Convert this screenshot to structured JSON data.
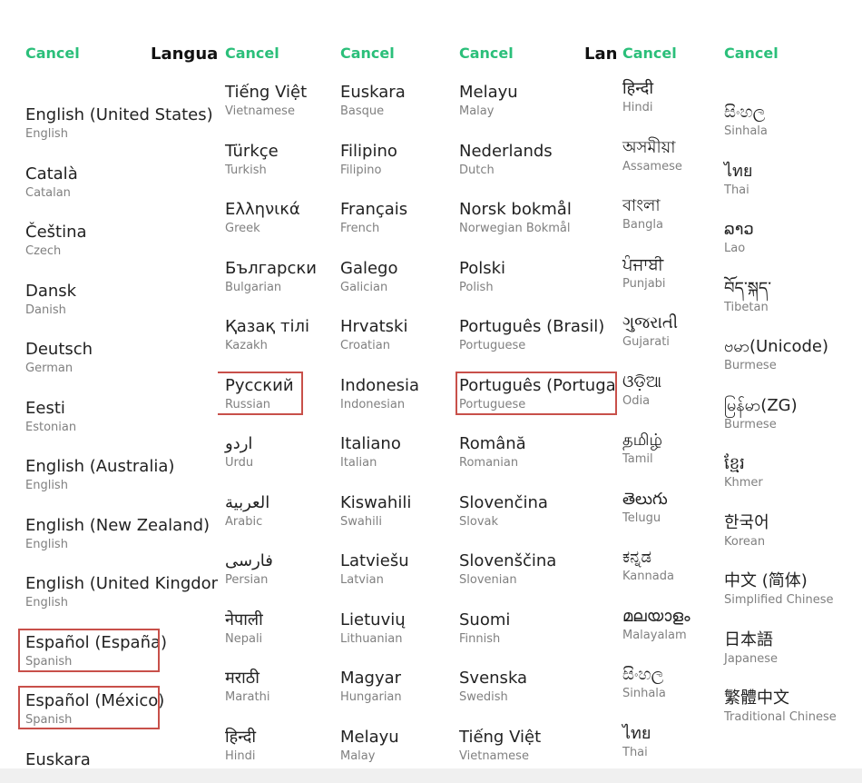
{
  "columns": [
    {
      "cancel": "Cancel",
      "title": "Languag",
      "items": [
        {
          "name": "English (United States)",
          "sub": "English"
        },
        {
          "name": "Català",
          "sub": "Catalan"
        },
        {
          "name": "Čeština",
          "sub": "Czech"
        },
        {
          "name": "Dansk",
          "sub": "Danish"
        },
        {
          "name": "Deutsch",
          "sub": "German"
        },
        {
          "name": "Eesti",
          "sub": "Estonian"
        },
        {
          "name": "English (Australia)",
          "sub": "English"
        },
        {
          "name": "English (New Zealand)",
          "sub": "English"
        },
        {
          "name": "English (United Kingdom)",
          "sub": "English"
        },
        {
          "name": "Español (España)",
          "sub": "Spanish"
        },
        {
          "name": "Español (México)",
          "sub": "Spanish"
        },
        {
          "name": "Euskara",
          "sub": ""
        }
      ]
    },
    {
      "cancel": "Cancel",
      "title": "",
      "items": [
        {
          "name": "Tiếng Việt",
          "sub": "Vietnamese"
        },
        {
          "name": "Türkçe",
          "sub": "Turkish"
        },
        {
          "name": "Ελληνικά",
          "sub": "Greek"
        },
        {
          "name": "Български",
          "sub": "Bulgarian"
        },
        {
          "name": "Қазақ тілі",
          "sub": "Kazakh"
        },
        {
          "name": "Русский",
          "sub": "Russian"
        },
        {
          "name": "اردو",
          "sub": "Urdu"
        },
        {
          "name": "العربية",
          "sub": "Arabic"
        },
        {
          "name": "فارسی",
          "sub": "Persian"
        },
        {
          "name": "नेपाली",
          "sub": "Nepali"
        },
        {
          "name": "मराठी",
          "sub": "Marathi"
        },
        {
          "name": "हिन्दी",
          "sub": "Hindi"
        }
      ]
    },
    {
      "cancel": "Cancel",
      "title": "",
      "items": [
        {
          "name": "Euskara",
          "sub": "Basque"
        },
        {
          "name": "Filipino",
          "sub": "Filipino"
        },
        {
          "name": "Français",
          "sub": "French"
        },
        {
          "name": "Galego",
          "sub": "Galician"
        },
        {
          "name": "Hrvatski",
          "sub": "Croatian"
        },
        {
          "name": "Indonesia",
          "sub": "Indonesian"
        },
        {
          "name": "Italiano",
          "sub": "Italian"
        },
        {
          "name": "Kiswahili",
          "sub": "Swahili"
        },
        {
          "name": "Latviešu",
          "sub": "Latvian"
        },
        {
          "name": "Lietuvių",
          "sub": "Lithuanian"
        },
        {
          "name": "Magyar",
          "sub": "Hungarian"
        },
        {
          "name": "Melayu",
          "sub": "Malay"
        }
      ]
    },
    {
      "cancel": "Cancel",
      "title": "Lang",
      "items": [
        {
          "name": "Melayu",
          "sub": "Malay"
        },
        {
          "name": "Nederlands",
          "sub": "Dutch"
        },
        {
          "name": "Norsk bokmål",
          "sub": "Norwegian Bokmål"
        },
        {
          "name": "Polski",
          "sub": "Polish"
        },
        {
          "name": "Português (Brasil)",
          "sub": "Portuguese"
        },
        {
          "name": "Português (Portugal)",
          "sub": "Portuguese"
        },
        {
          "name": "Română",
          "sub": "Romanian"
        },
        {
          "name": "Slovenčina",
          "sub": "Slovak"
        },
        {
          "name": "Slovenščina",
          "sub": "Slovenian"
        },
        {
          "name": "Suomi",
          "sub": "Finnish"
        },
        {
          "name": "Svenska",
          "sub": "Swedish"
        },
        {
          "name": "Tiếng Việt",
          "sub": "Vietnamese"
        }
      ]
    },
    {
      "cancel": "Cancel",
      "title": "",
      "items": [
        {
          "name": "हिन्दी",
          "sub": "Hindi"
        },
        {
          "name": "অসমীয়া",
          "sub": "Assamese"
        },
        {
          "name": "বাংলা",
          "sub": "Bangla"
        },
        {
          "name": "ਪੰਜਾਬੀ",
          "sub": "Punjabi"
        },
        {
          "name": "ગુજરાતી",
          "sub": "Gujarati"
        },
        {
          "name": "ଓଡ଼ିଆ",
          "sub": "Odia"
        },
        {
          "name": "தமிழ்",
          "sub": "Tamil"
        },
        {
          "name": "తెలుగు",
          "sub": "Telugu"
        },
        {
          "name": "ಕನ್ನಡ",
          "sub": "Kannada"
        },
        {
          "name": "മലയാളം",
          "sub": "Malayalam"
        },
        {
          "name": "සිංහල",
          "sub": "Sinhala"
        },
        {
          "name": "ไทย",
          "sub": "Thai"
        }
      ]
    },
    {
      "cancel": "Cancel",
      "title": "",
      "items": [
        {
          "name": "සිංහල",
          "sub": "Sinhala"
        },
        {
          "name": "ไทย",
          "sub": "Thai"
        },
        {
          "name": "ລາວ",
          "sub": "Lao"
        },
        {
          "name": "བོད་སྐད་",
          "sub": "Tibetan"
        },
        {
          "name": "ဗမာ(Unicode)",
          "sub": "Burmese"
        },
        {
          "name": "မြန်မာ(ZG)",
          "sub": "Burmese"
        },
        {
          "name": "ខ្មែរ",
          "sub": "Khmer"
        },
        {
          "name": "한국어",
          "sub": "Korean"
        },
        {
          "name": "中文 (简体)",
          "sub": "Simplified Chinese"
        },
        {
          "name": "日本語",
          "sub": "Japanese"
        },
        {
          "name": "繁體中文",
          "sub": "Traditional Chinese"
        }
      ]
    }
  ],
  "colors": {
    "accent": "#2bbf7a",
    "highlight_border": "#c8504a"
  }
}
